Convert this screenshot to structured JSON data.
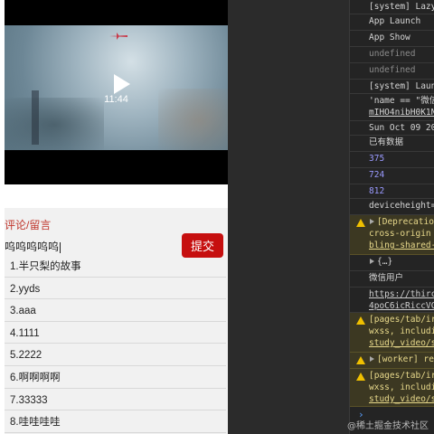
{
  "video": {
    "time": "11:44"
  },
  "comments": {
    "title": "评论/留言",
    "input_value": "呜呜呜呜呜",
    "submit_label": "提交",
    "items": [
      "1.半只梨的故事",
      "2.yyds",
      "3.aaa",
      "4.1111",
      "5.2222",
      "6.啊啊啊啊",
      "7.33333",
      "8.哇哇哇哇"
    ]
  },
  "console": {
    "rows": [
      {
        "text": "[system] Lazy",
        "kind": "normal"
      },
      {
        "text": "App Launch",
        "kind": "normal"
      },
      {
        "text": "App Show",
        "kind": "normal"
      },
      {
        "text": "undefined",
        "kind": "dim"
      },
      {
        "text": "undefined",
        "kind": "dim"
      },
      {
        "text": "[system] Laun",
        "kind": "normal"
      },
      {
        "text": "'name == \"微信",
        "line2": "mIHO4nibH0K1N",
        "kind": "normal"
      },
      {
        "text": "Sun Oct 09 20",
        "kind": "normal"
      },
      {
        "text": "已有数据",
        "kind": "normal"
      },
      {
        "text": "375",
        "kind": "num"
      },
      {
        "text": "724",
        "kind": "num"
      },
      {
        "text": "812",
        "kind": "num"
      },
      {
        "text": "deviceheight=",
        "kind": "normal"
      },
      {
        "text": "[Deprecation",
        "line2": "cross-origin",
        "line3": "bling-shared-",
        "kind": "warn"
      },
      {
        "text": "{…}",
        "kind": "normal"
      },
      {
        "text": "微信用户",
        "kind": "normal"
      },
      {
        "text": "https://thirc",
        "line2": "4poC6icRiccVC",
        "kind": "link"
      },
      {
        "text": "[pages/tab/ir",
        "line2": "wxss, includi",
        "line3": "study_video/s",
        "kind": "warn"
      },
      {
        "text": "[worker] re",
        "kind": "warn"
      },
      {
        "text": "[pages/tab/ir",
        "line2": "wxss, includi",
        "line3": "study_video/s",
        "kind": "warn"
      }
    ],
    "prompt": "›"
  },
  "watermark": "@稀土掘金技术社区",
  "colors": {
    "accent_red": "#c60f0f",
    "title_red": "#c0362c",
    "warn_bg": "#3c3822",
    "warn_icon": "#f0c000"
  }
}
